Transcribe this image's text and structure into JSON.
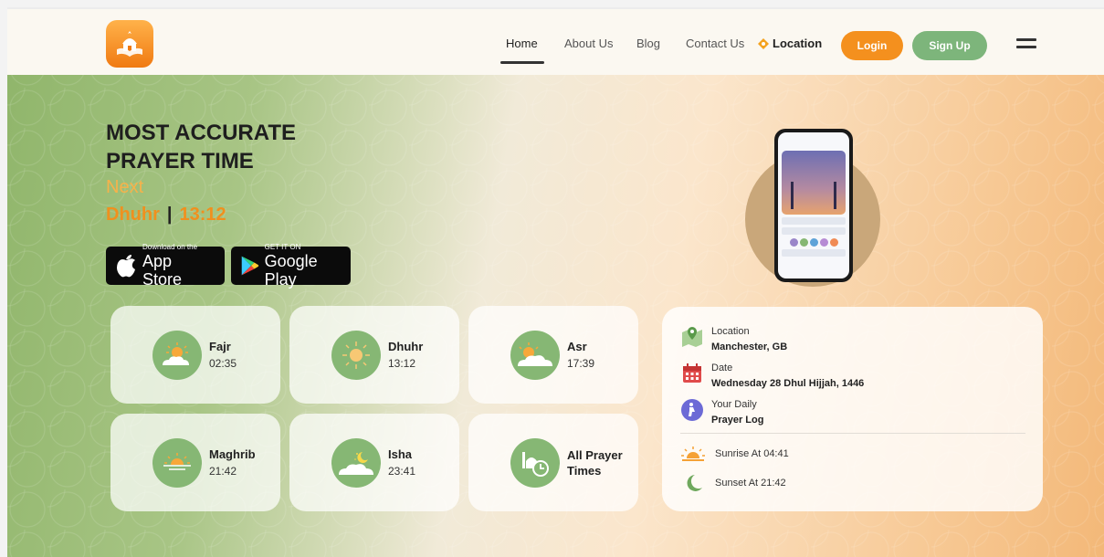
{
  "nav": {
    "links": [
      "Home",
      "About Us",
      "Blog",
      "Contact Us"
    ],
    "location": "Location",
    "login": "Login",
    "signup": "Sign Up"
  },
  "hero": {
    "title_line1": "MOST ACCURATE",
    "title_line2": "PRAYER TIME",
    "next_label": "Next",
    "next_prayer": "Dhuhr",
    "next_separator": "|",
    "next_time": "13:12"
  },
  "stores": {
    "apple_small": "Download on the",
    "apple_big": "App Store",
    "google_small": "GET IT ON",
    "google_big": "Google Play"
  },
  "prayers": [
    {
      "name": "Fajr",
      "time": "02:35",
      "icon": "sun-cloud-icon"
    },
    {
      "name": "Dhuhr",
      "time": "13:12",
      "icon": "sun-icon"
    },
    {
      "name": "Asr",
      "time": "17:39",
      "icon": "sun-cloud-icon"
    },
    {
      "name": "Maghrib",
      "time": "21:42",
      "icon": "sunset-icon"
    },
    {
      "name": "Isha",
      "time": "23:41",
      "icon": "moon-cloud-icon"
    }
  ],
  "all_prayer": {
    "line1": "All Prayer",
    "line2": "Times"
  },
  "info": {
    "location_label": "Location",
    "location_value": "Manchester, GB",
    "date_label": "Date",
    "date_value": "Wednesday 28 Dhul Hijjah, 1446",
    "log_label": "Your Daily",
    "log_value": "Prayer Log",
    "sunrise": "Sunrise At 04:41",
    "sunset": "Sunset At 21:42"
  },
  "colors": {
    "accent_orange": "#f4901e",
    "accent_green": "#7db57b"
  }
}
